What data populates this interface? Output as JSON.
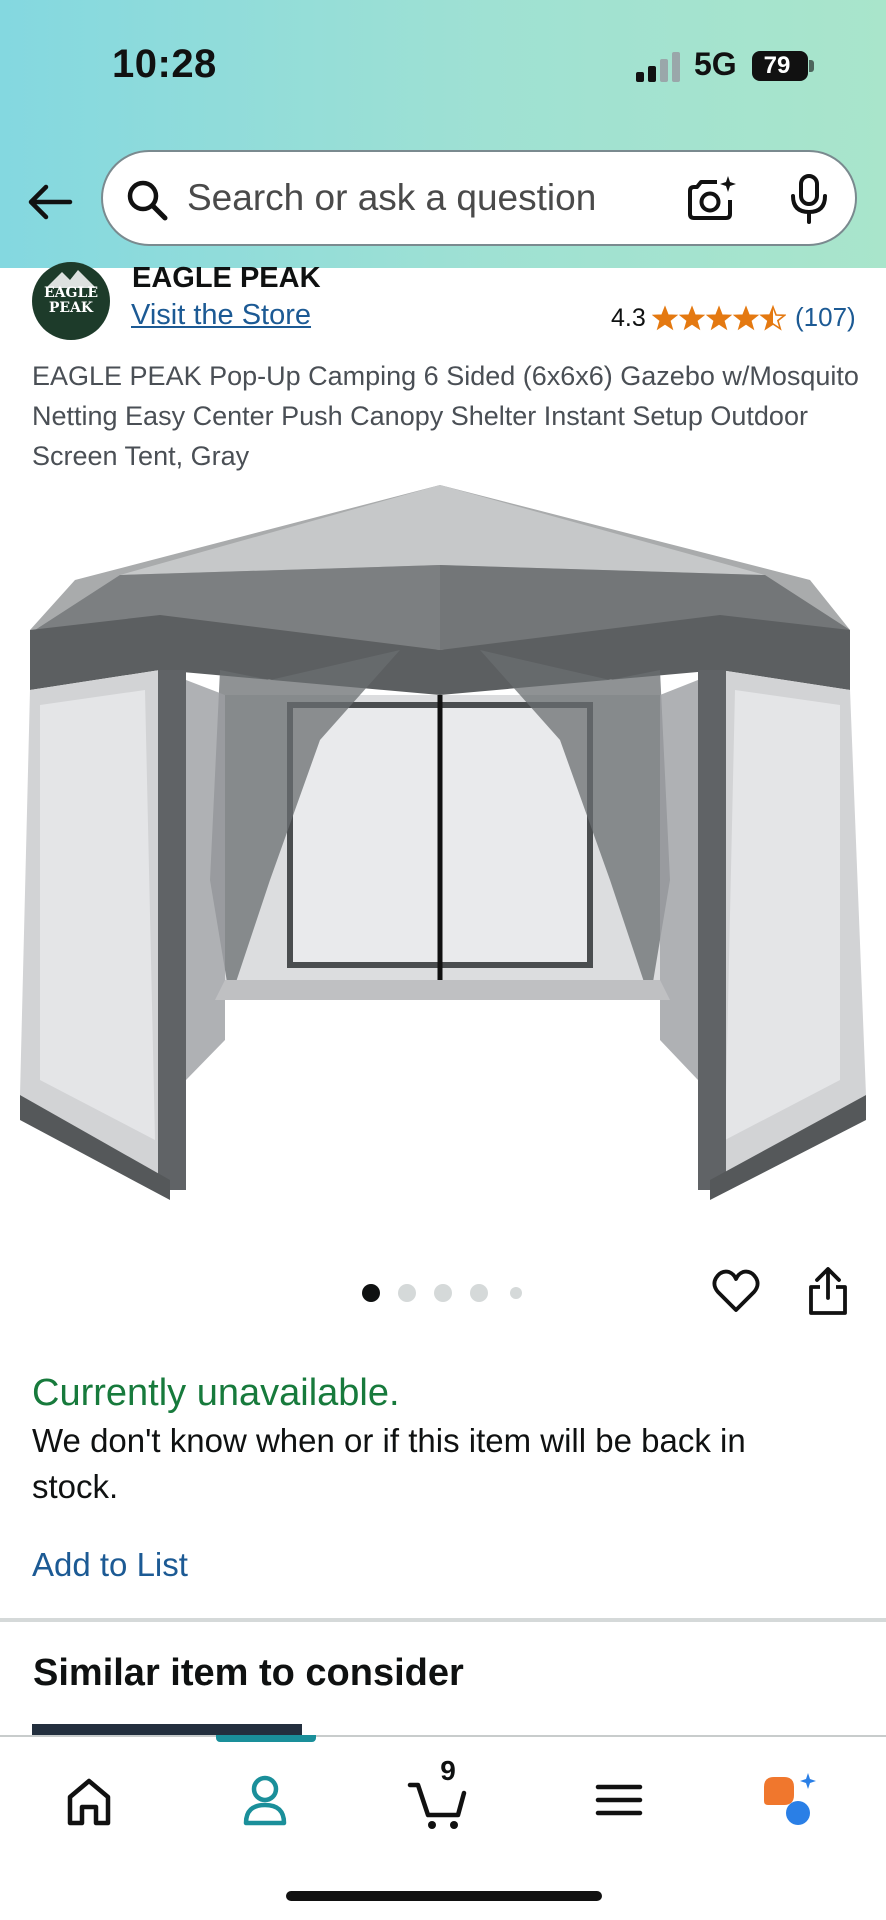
{
  "status_bar": {
    "time": "10:28",
    "network": "5G",
    "battery": "79"
  },
  "search": {
    "placeholder": "Search or ask a question"
  },
  "brand": {
    "logo_text": "EAGLE PEAK",
    "name": "EAGLE PEAK",
    "visit_store": "Visit the Store"
  },
  "rating": {
    "value": "4.3",
    "stars": 4.3,
    "count": "(107)"
  },
  "product": {
    "title": "EAGLE PEAK Pop-Up Camping 6 Sided (6x6x6) Gazebo w/Mosquito Netting Easy Center Push Canopy Shelter Instant Setup Outdoor Screen Tent, Gray"
  },
  "carousel": {
    "total_dots": 5,
    "active_index": 0
  },
  "availability": {
    "status": "Currently unavailable.",
    "description": "We don't know when or if this item will be back in stock.",
    "add_to_list": "Add to List"
  },
  "similar": {
    "heading": "Similar item to consider"
  },
  "bottom_nav": {
    "items": [
      "home-icon",
      "account-icon",
      "cart-icon",
      "menu-icon",
      "rufus-ai-icon"
    ],
    "active": "account-icon",
    "cart_count": "9"
  },
  "colors": {
    "accent": "#1c5a94",
    "available_green": "#177a3c",
    "star": "#e47911",
    "nav_active": "#1a8f9a",
    "ai_orange": "#f0772d",
    "ai_blue": "#2a7fe6"
  }
}
